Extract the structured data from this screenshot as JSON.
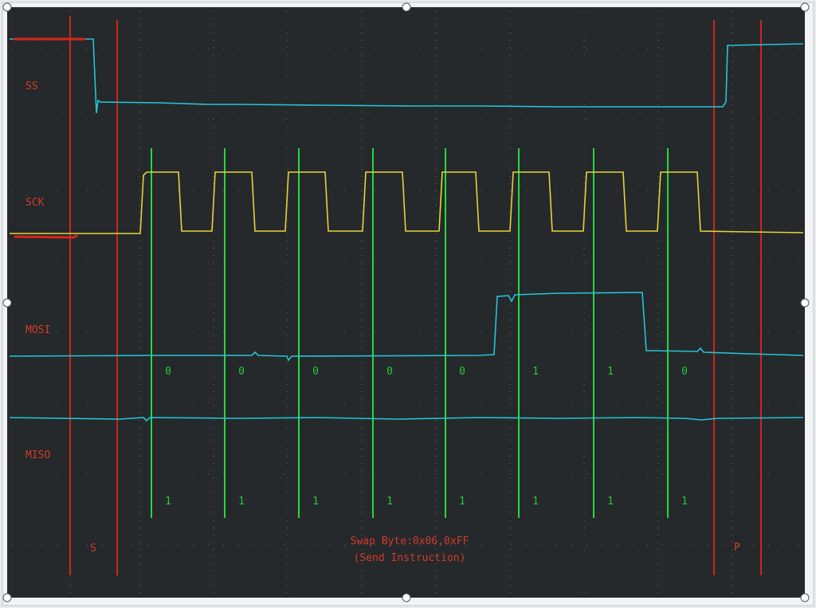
{
  "signals": {
    "ss": "SS",
    "sck": "SCK",
    "mosi": "MOSI",
    "miso": "MISO"
  },
  "markers": {
    "start": "S",
    "stop": "P"
  },
  "caption": {
    "line1": "Swap Byte:0x06,0xFF",
    "line2": "(Send Instruction)"
  },
  "mosi_bits": [
    "0",
    "0",
    "0",
    "0",
    "0",
    "1",
    "1",
    "0"
  ],
  "miso_bits": [
    "1",
    "1",
    "1",
    "1",
    "1",
    "1",
    "1",
    "1"
  ],
  "colors": {
    "background": "#25292b",
    "trace_cyan": "#26c3d6",
    "trace_yellow": "#e6d23a",
    "marker_red": "#c8261e",
    "sample_green": "#27d83f",
    "label_red": "#d23a2a"
  }
}
